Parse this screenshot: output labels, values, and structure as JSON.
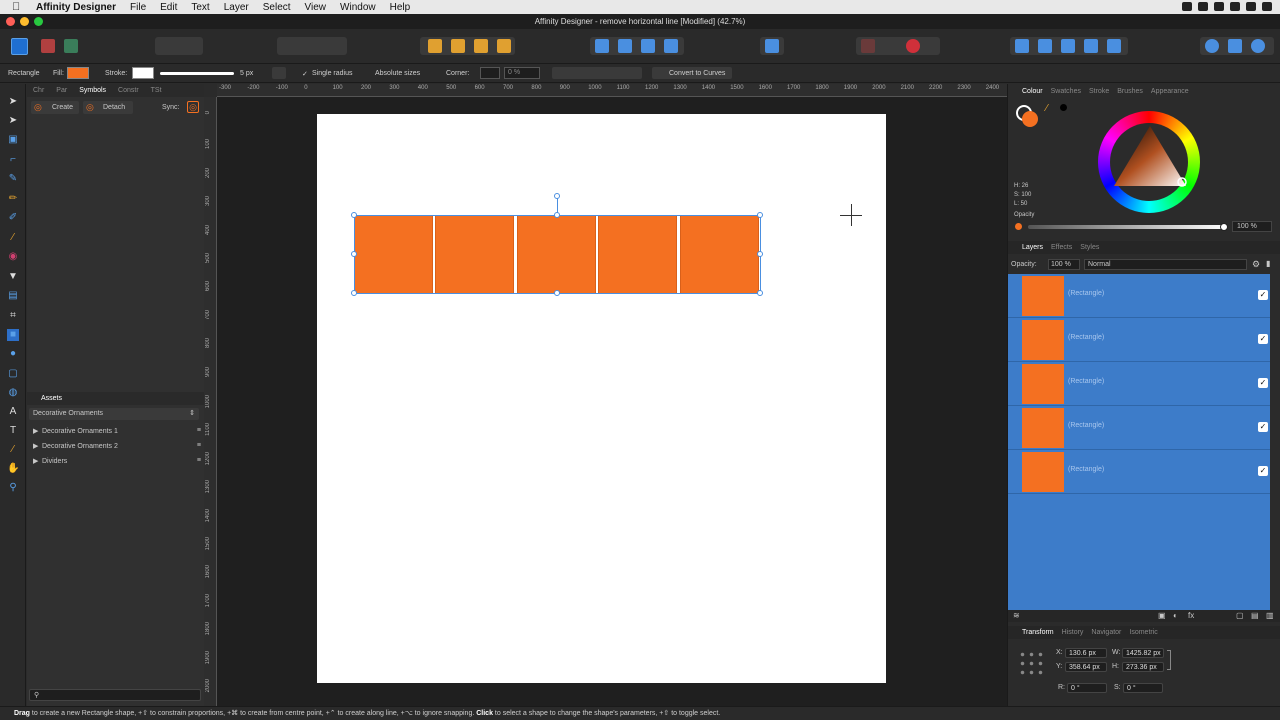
{
  "menubar": {
    "app": "Affinity Designer",
    "items": [
      "File",
      "Edit",
      "Text",
      "Layer",
      "Select",
      "View",
      "Window",
      "Help"
    ]
  },
  "window": {
    "title": "Affinity Designer - remove horizontal line [Modified] (42.7%)"
  },
  "context": {
    "shape": "Rectangle",
    "fill_label": "Fill:",
    "stroke_label": "Stroke:",
    "stroke_width": "5 px",
    "single_radius": "Single radius",
    "absolute_sizes": "Absolute sizes",
    "corner_label": "Corner:",
    "corner_value": "0 %",
    "convert": "Convert to Curves",
    "fill_color": "#f47021"
  },
  "leftpanel": {
    "tabs": [
      "Chr",
      "Par",
      "Symbols",
      "Constr",
      "TSt"
    ],
    "create": "Create",
    "detach": "Detach",
    "sync": "Sync:",
    "assets_tab": "Assets",
    "assets_dropdown": "Decorative Ornaments",
    "asset_items": [
      "Decorative Ornaments 1",
      "Decorative Ornaments 2",
      "Dividers"
    ]
  },
  "hruler": [
    "-300",
    "-200",
    "-100",
    "0",
    "100",
    "200",
    "300",
    "400",
    "500",
    "600",
    "700",
    "800",
    "900",
    "1000",
    "1100",
    "1200",
    "1300",
    "1400",
    "1500",
    "1600",
    "1700",
    "1800",
    "1900",
    "2000",
    "2100",
    "2200",
    "2300",
    "2400"
  ],
  "vruler": [
    "0",
    "100",
    "200",
    "300",
    "400",
    "500",
    "600",
    "700",
    "800",
    "900",
    "1000",
    "1100",
    "1200",
    "1300",
    "1400",
    "1500",
    "1600",
    "1700",
    "1800",
    "1900",
    "2000"
  ],
  "colour": {
    "tabs": [
      "Colour",
      "Swatches",
      "Stroke",
      "Brushes",
      "Appearance"
    ],
    "h": "H: 26",
    "s": "S: 100",
    "l": "L: 50",
    "opacity_label": "Opacity",
    "opacity_value": "100 %"
  },
  "layers": {
    "tabs": [
      "Layers",
      "Effects",
      "Styles"
    ],
    "opacity_label": "Opacity:",
    "opacity_value": "100 %",
    "blend": "Normal",
    "items": [
      "(Rectangle)",
      "(Rectangle)",
      "(Rectangle)",
      "(Rectangle)",
      "(Rectangle)"
    ]
  },
  "transform": {
    "tabs": [
      "Transform",
      "History",
      "Navigator",
      "Isometric"
    ],
    "x": "130.6 px",
    "y": "358.64 px",
    "w": "1425.82 px",
    "h": "273.36 px",
    "r": "0 °",
    "s": "0 °",
    "x_label": "X:",
    "y_label": "Y:",
    "w_label": "W:",
    "h_label": "H:",
    "r_label": "R:",
    "s_label": "S:"
  },
  "status": {
    "drag": "Drag",
    "text1": " to create a new Rectangle shape, +⇧ to constrain proportions, +⌘ to create from centre point, +⌃ to create along line, +⌥ to ignore snapping. ",
    "click": "Click",
    "text2": " to select a shape to change the shape's parameters, +⇧ to toggle select."
  }
}
